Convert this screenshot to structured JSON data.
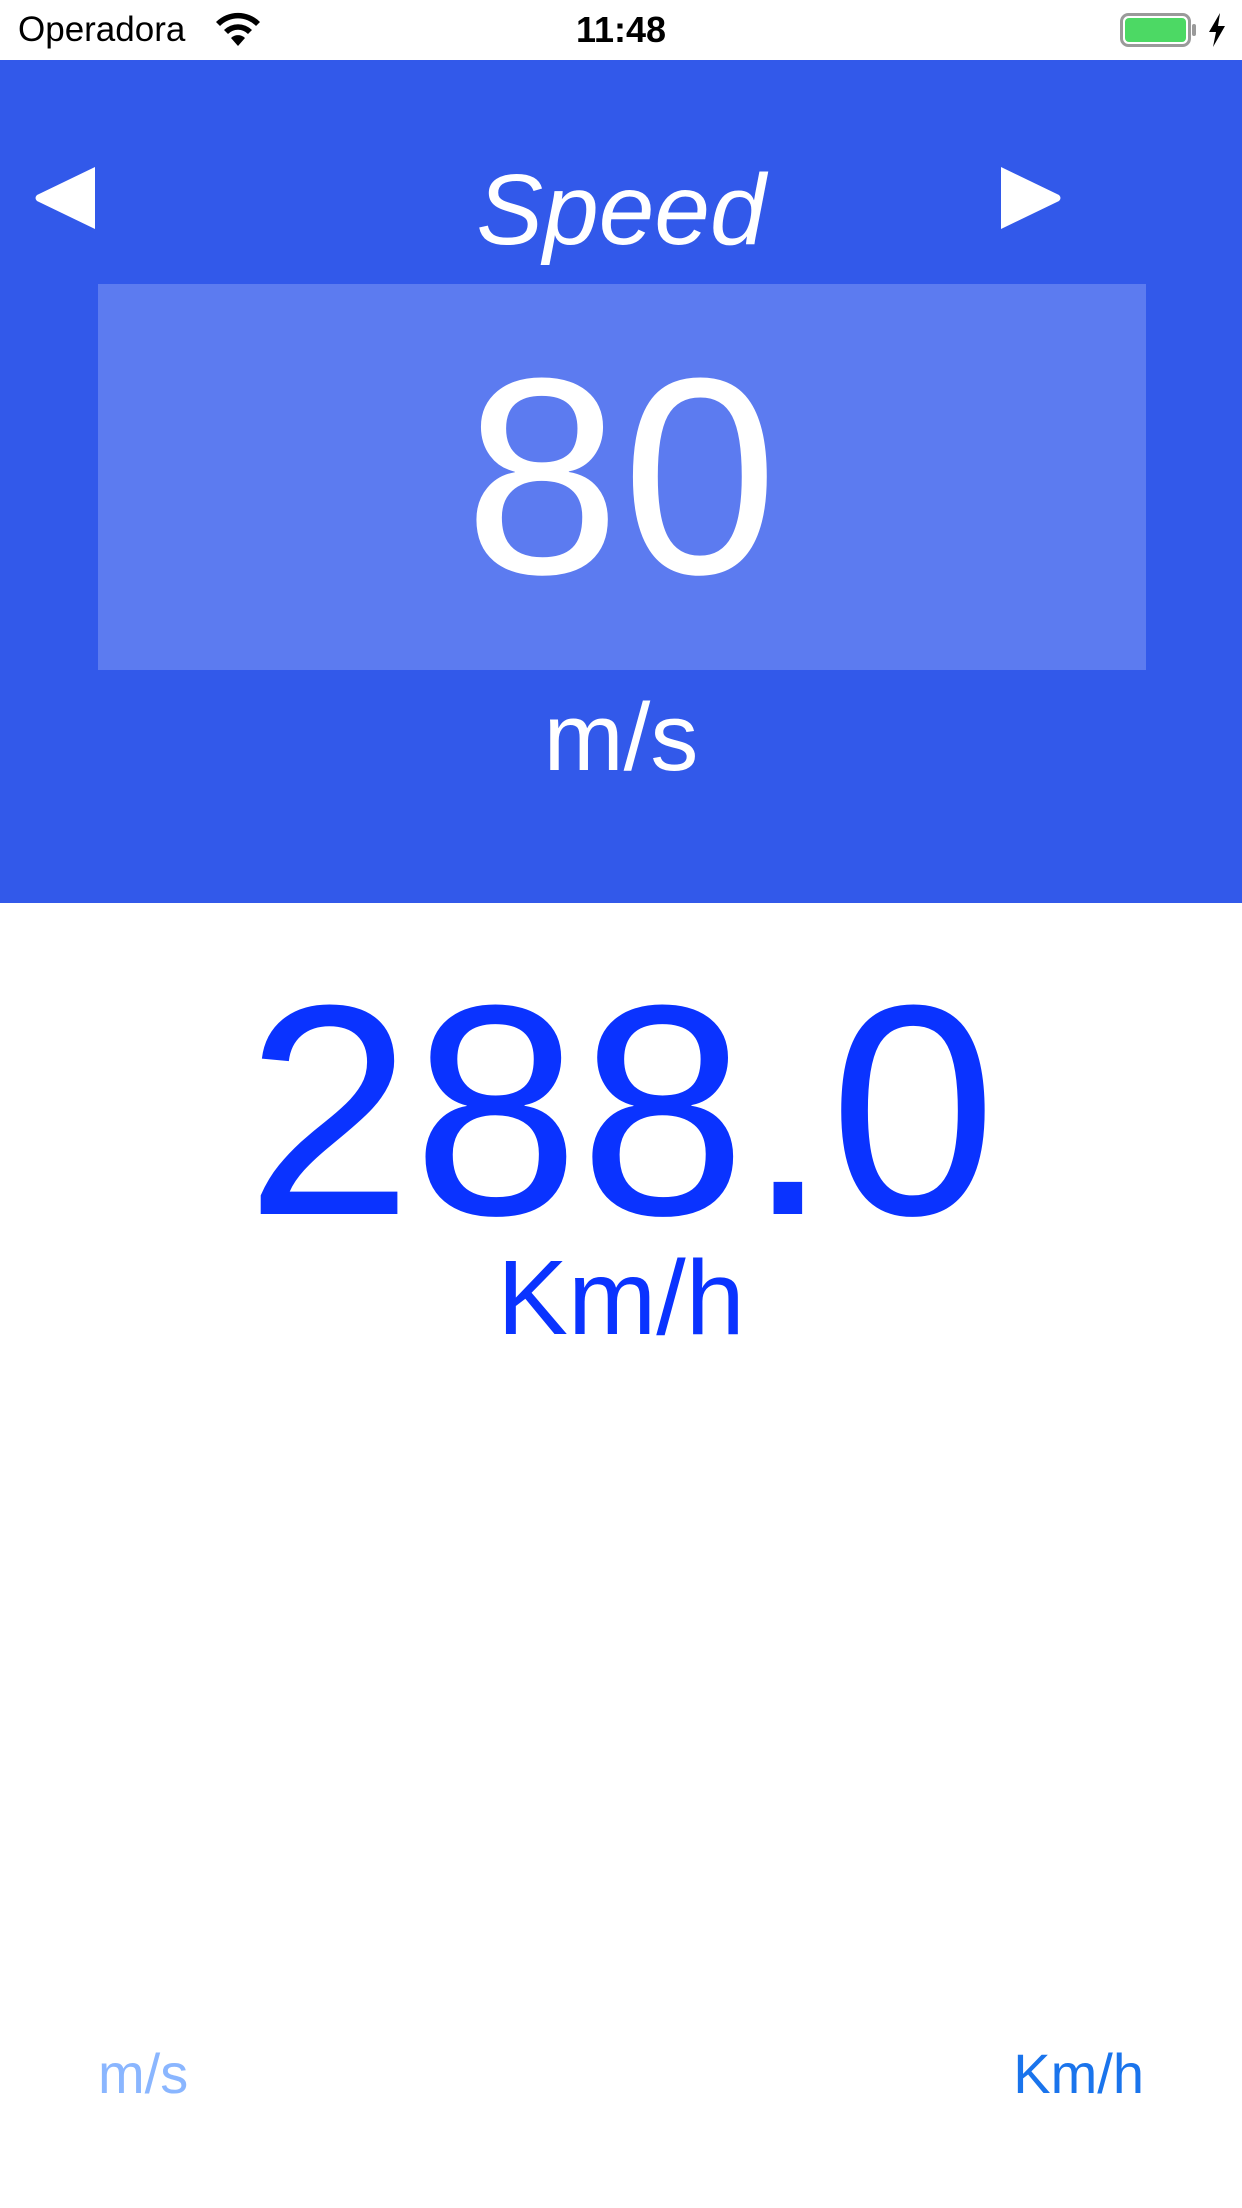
{
  "status_bar": {
    "carrier": "Operadora",
    "time": "11:48",
    "icons": [
      "wifi-icon",
      "battery-icon",
      "charging-icon"
    ],
    "battery_color": "#4cd964"
  },
  "header": {
    "title": "Speed",
    "input_value": "80",
    "input_unit": "m/s",
    "prev_icon": "triangle-left-icon",
    "next_icon": "triangle-right-icon"
  },
  "result": {
    "value": "288.0",
    "unit": "Km/h"
  },
  "unit_selector": {
    "left_option": "m/s",
    "right_option": "Km/h"
  },
  "colors": {
    "header_bg": "#3259ea",
    "input_box_bg": "#5c7bf0",
    "result_text": "#0a33ff",
    "unit_inactive": "#8ab6ff",
    "unit_active": "#1a74ec",
    "white": "#ffffff"
  }
}
